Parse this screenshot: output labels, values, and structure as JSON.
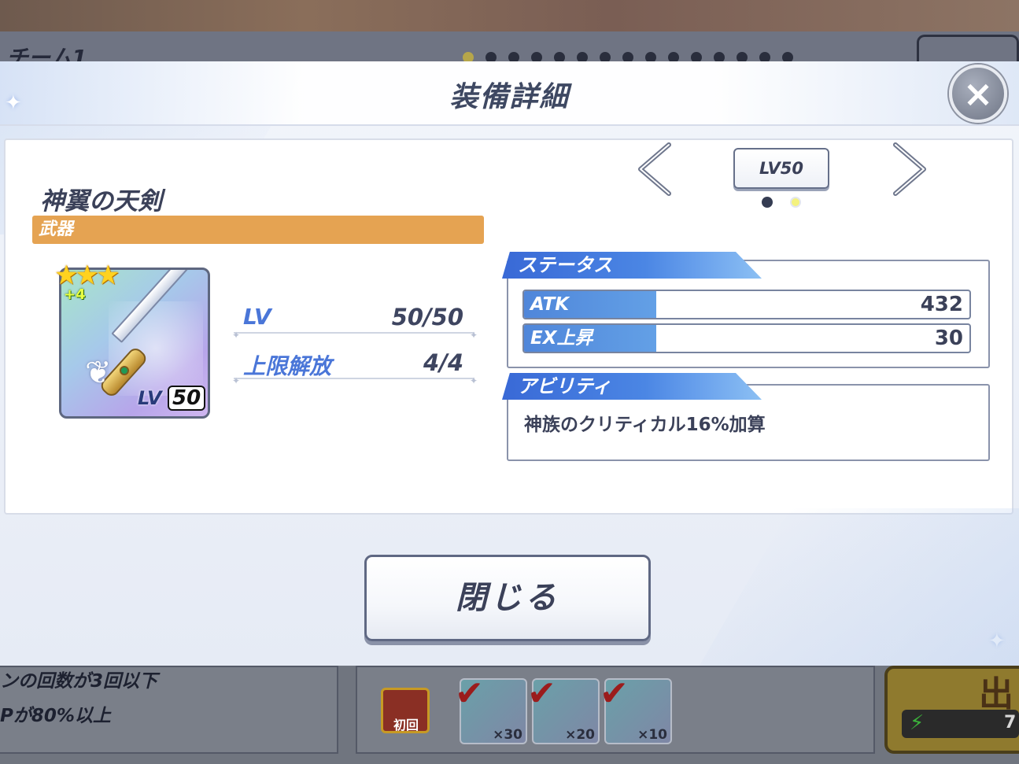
{
  "background": {
    "team_label": "チーム1",
    "condition_1": "ンの回数が3回以下",
    "condition_2": "Pが80%以上",
    "chest_label": "初回",
    "rewards": [
      {
        "count": "×30"
      },
      {
        "count": "×20"
      },
      {
        "count": "×10"
      }
    ],
    "right_label": "出",
    "energy_value": "7"
  },
  "modal": {
    "title": "装備詳細",
    "close_icon": "×",
    "close_button": "閉じる"
  },
  "equipment": {
    "name": "神翼の天剣",
    "category": "武器",
    "rarity_stars": 3,
    "stars_text": "★★★",
    "plus": "+4",
    "card_lv_label": "LV",
    "card_lv_value": "50",
    "level_label": "LV",
    "level_value": "50/50",
    "limit_label": "上限解放",
    "limit_value": "4/4"
  },
  "level_nav": {
    "badge": "LV50",
    "page_count": 2,
    "active_page": 1
  },
  "status": {
    "heading": "ステータス",
    "rows": [
      {
        "name": "ATK",
        "value": "432"
      },
      {
        "name": "EX上昇",
        "value": "30"
      }
    ]
  },
  "ability": {
    "heading": "アビリティ",
    "text": "神族のクリティカル16%加算"
  },
  "colors": {
    "category_bar": "#e5a352",
    "stat_blue": "#4f86da",
    "star_gold": "#ffd21f"
  }
}
